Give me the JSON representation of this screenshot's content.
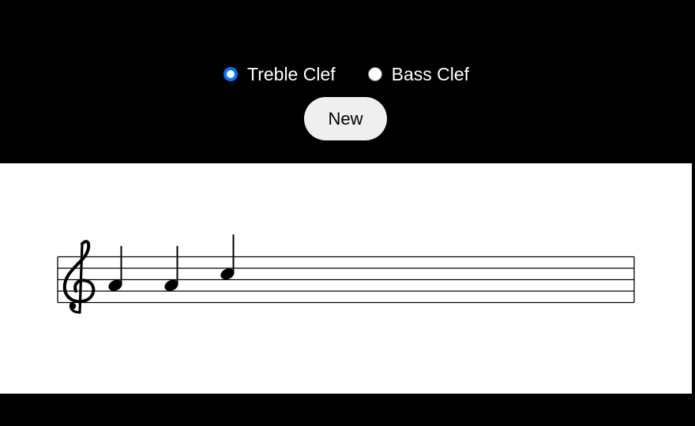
{
  "clef_options": [
    {
      "label": "Treble Clef",
      "value": "treble",
      "checked": true
    },
    {
      "label": "Bass Clef",
      "value": "bass",
      "checked": false
    }
  ],
  "new_button": {
    "label": "New"
  },
  "staff": {
    "clef": "treble",
    "clef_icon": "treble-clef-icon",
    "notes": [
      {
        "pitch": "A4",
        "duration": "quarter"
      },
      {
        "pitch": "A4",
        "duration": "quarter"
      },
      {
        "pitch": "C5",
        "duration": "quarter"
      }
    ]
  },
  "colors": {
    "accent": "#0075ff",
    "background": "#000000",
    "staff_background": "#ffffff",
    "button_background": "#efefef"
  }
}
